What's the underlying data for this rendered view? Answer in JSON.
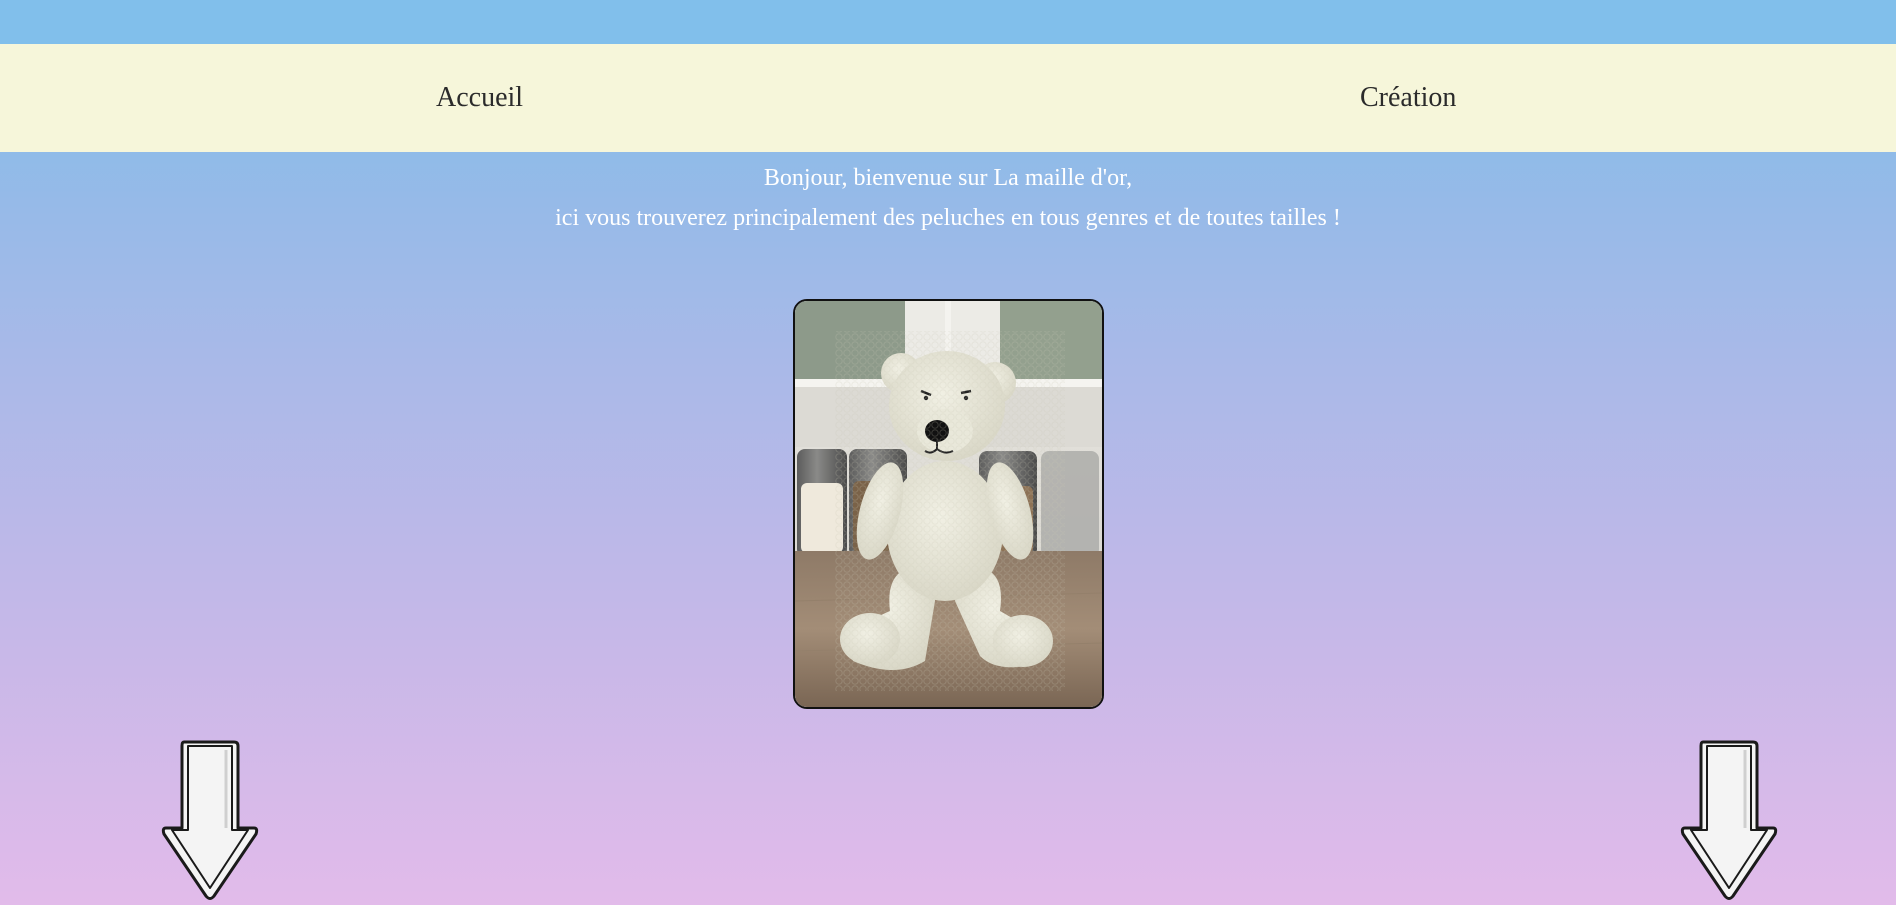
{
  "nav": {
    "items": [
      {
        "label": "Accueil"
      },
      {
        "label": "Création"
      }
    ]
  },
  "welcome": {
    "line1": "Bonjour, bienvenue sur La maille d'or,",
    "line2": "ici vous trouverez principalement des peluches en tous genres et de toutes tailles !"
  },
  "photo": {
    "subject": "crocheted cream teddy bear sitting on a wooden counter in front of glass jars"
  },
  "arrows": {
    "icon": "arrow-down-icon"
  },
  "colors": {
    "top_strip": "#81bfeb",
    "nav_background": "#f6f6da",
    "nav_text": "#2b2b2b",
    "welcome_text": "#ffffff",
    "gradient_top": "#8cbce8",
    "gradient_bottom": "#e2bbea"
  }
}
